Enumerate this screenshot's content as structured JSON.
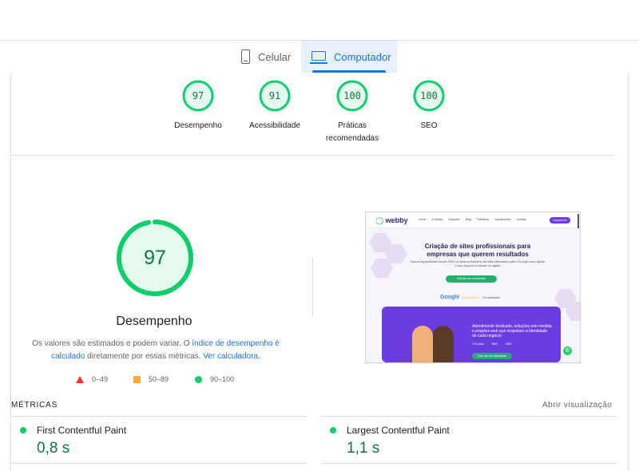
{
  "device_tabs": {
    "mobile": {
      "label": "Celular",
      "icon": "phone-icon"
    },
    "desktop": {
      "label": "Computador",
      "icon": "monitor-icon",
      "selected": true
    }
  },
  "category_scores": [
    {
      "score": "97",
      "label_lines": [
        "Desempenho"
      ]
    },
    {
      "score": "91",
      "label_lines": [
        "Acessibilidade"
      ]
    },
    {
      "score": "100",
      "label_lines": [
        "Práticas",
        "recomendadas"
      ]
    },
    {
      "score": "100",
      "label_lines": [
        "SEO"
      ]
    }
  ],
  "performance": {
    "score": "97",
    "title": "Desempenho",
    "desc_prefix": "Os valores são estimados e podem variar. O ",
    "desc_link1": "índice de desempenho é calculado",
    "desc_middle": " diretamente por essas métricas. ",
    "desc_link2": "Ver calculadora."
  },
  "legend": [
    {
      "range": "0–49",
      "shape": "triangle",
      "color": "#ff3333"
    },
    {
      "range": "50–89",
      "shape": "square",
      "color": "#ffaa33"
    },
    {
      "range": "90–100",
      "shape": "circle",
      "color": "#0cce6b"
    }
  ],
  "thumbnail": {
    "logo": "webby",
    "nav_links": [
      "Home",
      "A Webby",
      "Soluções",
      "Blog",
      "Trabalhos",
      "Depoimentos",
      "Contato"
    ],
    "cta": "Orçamento",
    "headline_1": "Criação de sites profissionais para",
    "headline_2": "empresas que querem resultados",
    "subtext": "Somos especialistas desde 2012 no desenvolvimento de sites otimizados para o Google para ajudar o seu negócio a crescer no digital",
    "button": "Solicite seu orçamento",
    "google_label": "Google",
    "rating": "★★★★★ 5.0",
    "reviews": "• 90 avaliações",
    "panel_text": "Atendimento dedicado, soluções sob medida e projetos web que respeitam a identidade de cada negócio",
    "stats": [
      "+13 anos",
      "98%",
      "+800"
    ],
    "panel_button": "Fale com um especialista"
  },
  "metrics": {
    "section_title": "MÉTRICAS",
    "toggle_label": "Abrir visualização",
    "items": [
      {
        "name": "First Contentful Paint",
        "value": "0,8 s",
        "status_color": "#0cce6b"
      },
      {
        "name": "Largest Contentful Paint",
        "value": "1,1 s",
        "status_color": "#0cce6b"
      }
    ]
  },
  "colors": {
    "pass": "#0cce6b",
    "pass_text": "#0c7a3a",
    "accent": "#1a73e8"
  }
}
